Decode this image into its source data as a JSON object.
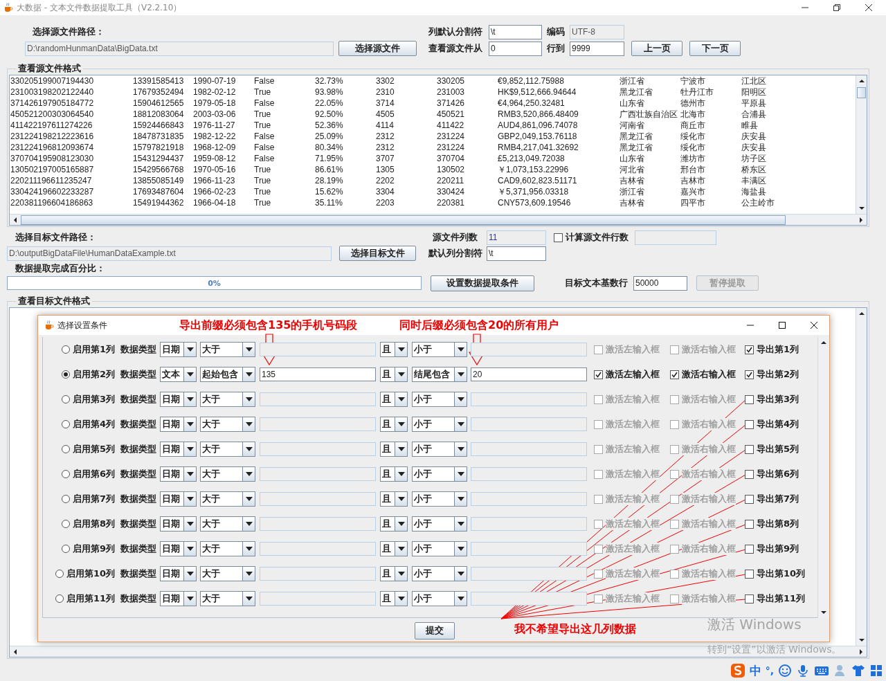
{
  "window": {
    "title": "大数据 - 文本文件数据提取工具（V2.2.10）"
  },
  "source": {
    "path_label": "选择源文件路径：",
    "path": "D:\\randomHunmanData\\BigData.txt",
    "choose_button": "选择源文件",
    "delimiter_label": "列默认分割符",
    "delimiter": "\\t",
    "encoding_label": "编码",
    "encoding": "UTF-8",
    "from_label": "查看源文件从",
    "from": "0",
    "to_label": "行到",
    "to": "9999",
    "prev_button": "上一页",
    "next_button": "下一页"
  },
  "source_view": {
    "title": "查看源文件格式",
    "rows": [
      [
        "330205199007194430",
        "13391585413",
        "1990-07-19",
        "False",
        "32.73%",
        "3302",
        "330205",
        "€9,852,112.75988",
        "浙江省",
        "宁波市",
        "江北区"
      ],
      [
        "231003198202122440",
        "17679352494",
        "1982-02-12",
        "True",
        "93.98%",
        "2310",
        "231003",
        "HK$9,512,666.94644",
        "黑龙江省",
        "牡丹江市",
        "阳明区"
      ],
      [
        "371426197905184772",
        "15904612565",
        "1979-05-18",
        "False",
        "22.05%",
        "3714",
        "371426",
        "€4,964,250.32481",
        "山东省",
        "德州市",
        "平原县"
      ],
      [
        "450521200303064540",
        "18812083064",
        "2003-03-06",
        "True",
        "92.50%",
        "4505",
        "450521",
        "RMB3,520,866.48409",
        "广西壮族自治区",
        "北海市",
        "合浦县"
      ],
      [
        "411422197611274226",
        "15924466843",
        "1976-11-27",
        "True",
        "52.36%",
        "4114",
        "411422",
        "AUD4,861,096.74078",
        "河南省",
        "商丘市",
        "睢县"
      ],
      [
        "231224198212223616",
        "18478731835",
        "1982-12-22",
        "False",
        "25.09%",
        "2312",
        "231224",
        "GBP2,049,153.76118",
        "黑龙江省",
        "绥化市",
        "庆安县"
      ],
      [
        "231224196812093674",
        "15797821918",
        "1968-12-09",
        "False",
        "80.34%",
        "2312",
        "231224",
        "RMB4,217,041.32692",
        "黑龙江省",
        "绥化市",
        "庆安县"
      ],
      [
        "370704195908123030",
        "15431294437",
        "1959-08-12",
        "False",
        "71.95%",
        "3707",
        "370704",
        "£5,213,049.72038",
        "山东省",
        "潍坊市",
        "坊子区"
      ],
      [
        "130502197005165887",
        "15429566768",
        "1970-05-16",
        "True",
        "86.61%",
        "1305",
        "130502",
        "￥1,073,153.22996",
        "河北省",
        "邢台市",
        "桥东区"
      ],
      [
        "220211196611235247",
        "13855085149",
        "1966-11-23",
        "True",
        "28.19%",
        "2202",
        "220211",
        "CAD9,602,823.51171",
        "吉林省",
        "吉林市",
        "丰满区"
      ],
      [
        "330424196602233287",
        "17693487604",
        "1966-02-23",
        "True",
        "15.62%",
        "3304",
        "330424",
        "￥5,371,956.03318",
        "浙江省",
        "嘉兴市",
        "海盐县"
      ],
      [
        "220381196604186863",
        "15491944362",
        "1966-04-18",
        "True",
        "35.11%",
        "2203",
        "220381",
        "CNY573,609.19546",
        "吉林省",
        "四平市",
        "公主岭市"
      ]
    ]
  },
  "target": {
    "path_label": "选择目标文件路径：",
    "path": "D:\\outputBigDataFile\\HumanDataExample.txt",
    "choose_button": "选择目标文件",
    "column_count_label": "源文件列数",
    "column_count": "11",
    "count_rows": {
      "label": "计算源文件行数",
      "checked": false
    },
    "delimiter_label": "默认列分割符",
    "delimiter": "\\t",
    "progress_label": "数据提取完成百分比：",
    "progress": {
      "level": 0,
      "text": "0%"
    },
    "conditions_button": "设置数据提取条件",
    "base_rows_label": "目标文本基数行",
    "base_rows": "50000",
    "pause_button": {
      "label": "暂停提取",
      "disabled": true
    }
  },
  "target_view": {
    "title": "查看目标文件格式"
  },
  "dialog": {
    "title": "选择设置条件",
    "submit_button": "提交",
    "rows": [
      {
        "selected": false,
        "label": "启用第1列",
        "type_label": "数据类型",
        "type": "日期",
        "op": "大于",
        "join": "且",
        "op2": "小于",
        "left_active": {
          "label": "激活左输入框",
          "checked": false,
          "disabled": true
        },
        "right_active": {
          "label": "激活右输入框",
          "checked": false,
          "disabled": true
        },
        "export": {
          "label": "导出第1列",
          "checked": true
        }
      },
      {
        "selected": true,
        "label": "启用第2列",
        "type_label": "数据类型",
        "type": "文本",
        "op": "起始包含",
        "left_value": "135",
        "join": "且",
        "op2": "结尾包含",
        "right_value": "20",
        "left_active": {
          "label": "激活左输入框",
          "checked": true,
          "disabled": false
        },
        "right_active": {
          "label": "激活右输入框",
          "checked": true,
          "disabled": false
        },
        "export": {
          "label": "导出第2列",
          "checked": true
        }
      },
      {
        "selected": false,
        "label": "启用第3列",
        "type_label": "数据类型",
        "type": "日期",
        "op": "大于",
        "join": "且",
        "op2": "小于",
        "left_active": {
          "label": "激活左输入框",
          "checked": false,
          "disabled": true
        },
        "right_active": {
          "label": "激活右输入框",
          "checked": false,
          "disabled": true
        },
        "export": {
          "label": "导出第3列",
          "checked": false
        }
      },
      {
        "selected": false,
        "label": "启用第4列",
        "type_label": "数据类型",
        "type": "日期",
        "op": "大于",
        "join": "且",
        "op2": "小于",
        "left_active": {
          "label": "激活左输入框",
          "checked": false,
          "disabled": true
        },
        "right_active": {
          "label": "激活右输入框",
          "checked": false,
          "disabled": true
        },
        "export": {
          "label": "导出第4列",
          "checked": false
        }
      },
      {
        "selected": false,
        "label": "启用第5列",
        "type_label": "数据类型",
        "type": "日期",
        "op": "大于",
        "join": "且",
        "op2": "小于",
        "left_active": {
          "label": "激活左输入框",
          "checked": false,
          "disabled": true
        },
        "right_active": {
          "label": "激活右输入框",
          "checked": false,
          "disabled": true
        },
        "export": {
          "label": "导出第5列",
          "checked": false
        }
      },
      {
        "selected": false,
        "label": "启用第6列",
        "type_label": "数据类型",
        "type": "日期",
        "op": "大于",
        "join": "且",
        "op2": "小于",
        "left_active": {
          "label": "激活左输入框",
          "checked": false,
          "disabled": true
        },
        "right_active": {
          "label": "激活右输入框",
          "checked": false,
          "disabled": true
        },
        "export": {
          "label": "导出第6列",
          "checked": false
        }
      },
      {
        "selected": false,
        "label": "启用第7列",
        "type_label": "数据类型",
        "type": "日期",
        "op": "大于",
        "join": "且",
        "op2": "小于",
        "left_active": {
          "label": "激活左输入框",
          "checked": false,
          "disabled": true
        },
        "right_active": {
          "label": "激活右输入框",
          "checked": false,
          "disabled": true
        },
        "export": {
          "label": "导出第7列",
          "checked": false
        }
      },
      {
        "selected": false,
        "label": "启用第8列",
        "type_label": "数据类型",
        "type": "日期",
        "op": "大于",
        "join": "且",
        "op2": "小于",
        "left_active": {
          "label": "激活左输入框",
          "checked": false,
          "disabled": true
        },
        "right_active": {
          "label": "激活右输入框",
          "checked": false,
          "disabled": true
        },
        "export": {
          "label": "导出第8列",
          "checked": false
        }
      },
      {
        "selected": false,
        "label": "启用第9列",
        "type_label": "数据类型",
        "type": "日期",
        "op": "大于",
        "join": "且",
        "op2": "小于",
        "left_active": {
          "label": "激活左输入框",
          "checked": false,
          "disabled": true
        },
        "right_active": {
          "label": "激活右输入框",
          "checked": false,
          "disabled": true
        },
        "export": {
          "label": "导出第9列",
          "checked": false
        }
      },
      {
        "selected": false,
        "label": "启用第10列",
        "type_label": "数据类型",
        "type": "日期",
        "op": "大于",
        "join": "且",
        "op2": "小于",
        "left_active": {
          "label": "激活左输入框",
          "checked": false,
          "disabled": true
        },
        "right_active": {
          "label": "激活右输入框",
          "checked": false,
          "disabled": true
        },
        "export": {
          "label": "导出第10列",
          "checked": false
        }
      },
      {
        "selected": false,
        "label": "启用第11列",
        "type_label": "数据类型",
        "type": "日期",
        "op": "大于",
        "join": "且",
        "op2": "小于",
        "left_active": {
          "label": "激活左输入框",
          "checked": false,
          "disabled": true
        },
        "right_active": {
          "label": "激活右输入框",
          "checked": false,
          "disabled": true
        },
        "export": {
          "label": "导出第11列",
          "checked": false
        }
      }
    ]
  },
  "annotations": [
    {
      "text": "导出前缀必须包含135的手机号码段"
    },
    {
      "text": "同时后缀必须包含20的所有用户"
    },
    {
      "text": "我不希望导出这几列数据"
    }
  ],
  "activation": {
    "title": "激活 Windows",
    "hint": "转到“设置”以激活 Windows。"
  },
  "ime": {
    "language": "中",
    "punctuation": "°,"
  }
}
